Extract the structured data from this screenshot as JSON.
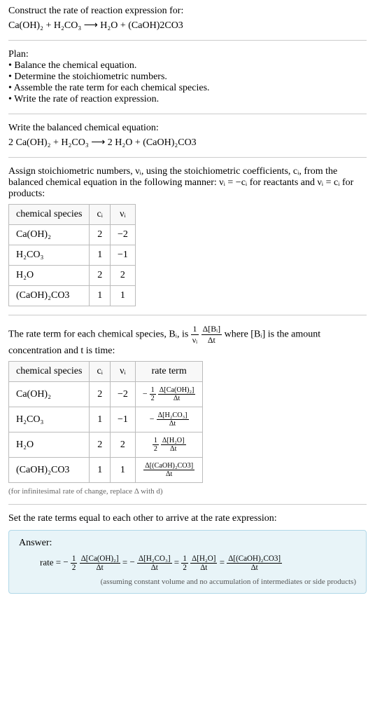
{
  "title": "Construct the rate of reaction expression for:",
  "initial_equation": "Ca(OH)₂ + H₂CO₃  ⟶  H₂O + (CaOH)2CO3",
  "plan": {
    "heading": "Plan:",
    "items": [
      "Balance the chemical equation.",
      "Determine the stoichiometric numbers.",
      "Assemble the rate term for each chemical species.",
      "Write the rate of reaction expression."
    ]
  },
  "balanced": {
    "heading": "Write the balanced chemical equation:",
    "equation": "2 Ca(OH)₂ + H₂CO₃  ⟶  2 H₂O + (CaOH)₂CO3"
  },
  "stoich": {
    "text1": "Assign stoichiometric numbers, νᵢ, using the stoichiometric coefficients, cᵢ, from the balanced chemical equation in the following manner: νᵢ = −cᵢ for reactants and νᵢ = cᵢ for products:",
    "headers": [
      "chemical species",
      "cᵢ",
      "νᵢ"
    ],
    "rows": [
      {
        "species": "Ca(OH)₂",
        "c": "2",
        "v": "−2"
      },
      {
        "species": "H₂CO₃",
        "c": "1",
        "v": "−1"
      },
      {
        "species": "H₂O",
        "c": "2",
        "v": "2"
      },
      {
        "species": "(CaOH)₂CO3",
        "c": "1",
        "v": "1"
      }
    ]
  },
  "rateterm": {
    "prefix": "The rate term for each chemical species, Bᵢ, is ",
    "frac1_num": "1",
    "frac1_den": "νᵢ",
    "frac2_num": "Δ[Bᵢ]",
    "frac2_den": "Δt",
    "suffix": " where [Bᵢ] is the amount concentration and t is time:",
    "headers": [
      "chemical species",
      "cᵢ",
      "νᵢ",
      "rate term"
    ],
    "rows": [
      {
        "species": "Ca(OH)₂",
        "c": "2",
        "v": "−2",
        "sign": "−",
        "coef_num": "1",
        "coef_den": "2",
        "d_num": "Δ[Ca(OH)₂]",
        "d_den": "Δt"
      },
      {
        "species": "H₂CO₃",
        "c": "1",
        "v": "−1",
        "sign": "−",
        "coef_num": "",
        "coef_den": "",
        "d_num": "Δ[H₂CO₃]",
        "d_den": "Δt"
      },
      {
        "species": "H₂O",
        "c": "2",
        "v": "2",
        "sign": "",
        "coef_num": "1",
        "coef_den": "2",
        "d_num": "Δ[H₂O]",
        "d_den": "Δt"
      },
      {
        "species": "(CaOH)₂CO3",
        "c": "1",
        "v": "1",
        "sign": "",
        "coef_num": "",
        "coef_den": "",
        "d_num": "Δ[(CaOH)₂CO3]",
        "d_den": "Δt"
      }
    ],
    "note": "(for infinitesimal rate of change, replace Δ with d)"
  },
  "final": {
    "heading": "Set the rate terms equal to each other to arrive at the rate expression:"
  },
  "answer": {
    "label": "Answer:",
    "rate_label": "rate = ",
    "terms": [
      {
        "sign": "−",
        "coef_num": "1",
        "coef_den": "2",
        "d_num": "Δ[Ca(OH)₂]",
        "d_den": "Δt"
      },
      {
        "sign": "−",
        "coef_num": "",
        "coef_den": "",
        "d_num": "Δ[H₂CO₃]",
        "d_den": "Δt"
      },
      {
        "sign": "",
        "coef_num": "1",
        "coef_den": "2",
        "d_num": "Δ[H₂O]",
        "d_den": "Δt"
      },
      {
        "sign": "",
        "coef_num": "",
        "coef_den": "",
        "d_num": "Δ[(CaOH)₂CO3]",
        "d_den": "Δt"
      }
    ],
    "note": "(assuming constant volume and no accumulation of intermediates or side products)"
  }
}
